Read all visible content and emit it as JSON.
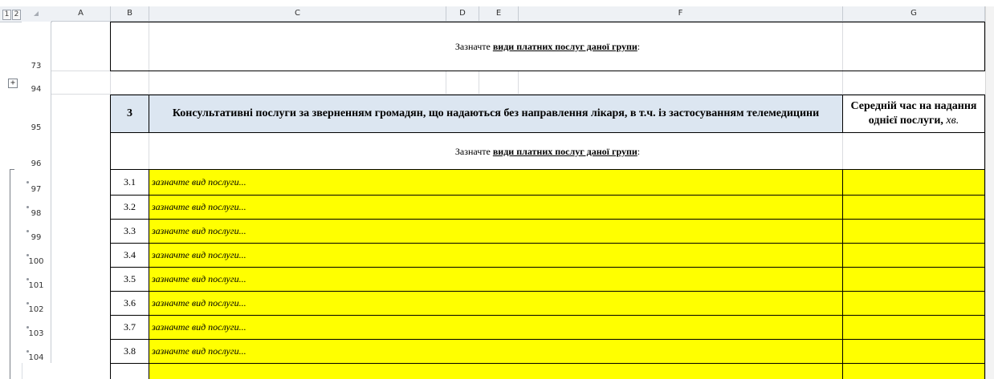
{
  "outline": {
    "level_buttons": [
      "1",
      "2"
    ]
  },
  "columns": [
    "A",
    "B",
    "C",
    "D",
    "E",
    "F",
    "G"
  ],
  "rows": {
    "r73": "73",
    "r94": "94",
    "r95": "95",
    "r96": "96",
    "r97": "97",
    "r98": "98",
    "r99": "99",
    "r100": "100",
    "r101": "101",
    "r102": "102",
    "r103": "103",
    "r104": "104"
  },
  "instruction": {
    "prefix": "Зазначте ",
    "emphasis": "види платних послуг даної групи",
    "suffix": ":"
  },
  "section": {
    "number": "3",
    "title": "Консультативні послуги за зверненням громадян, що надаються без направлення лікаря, в т.ч. із застосуванням телемедицини",
    "avg_time_line1": "Середній час на надання",
    "avg_time_line2": "однієї послуги, ",
    "avg_time_unit": "хв."
  },
  "items": [
    {
      "num": "3.1",
      "text": "зазначте вид послуги..."
    },
    {
      "num": "3.2",
      "text": "зазначте вид послуги..."
    },
    {
      "num": "3.3",
      "text": "зазначте вид послуги..."
    },
    {
      "num": "3.4",
      "text": "зазначте вид послуги..."
    },
    {
      "num": "3.5",
      "text": "зазначте вид послуги..."
    },
    {
      "num": "3.6",
      "text": "зазначте вид послуги..."
    },
    {
      "num": "3.7",
      "text": "зазначте вид послуги..."
    },
    {
      "num": "3.8",
      "text": "зазначте вид послуги..."
    }
  ],
  "colors": {
    "highlight": "#ffff00",
    "header_fill": "#dce6f1"
  }
}
